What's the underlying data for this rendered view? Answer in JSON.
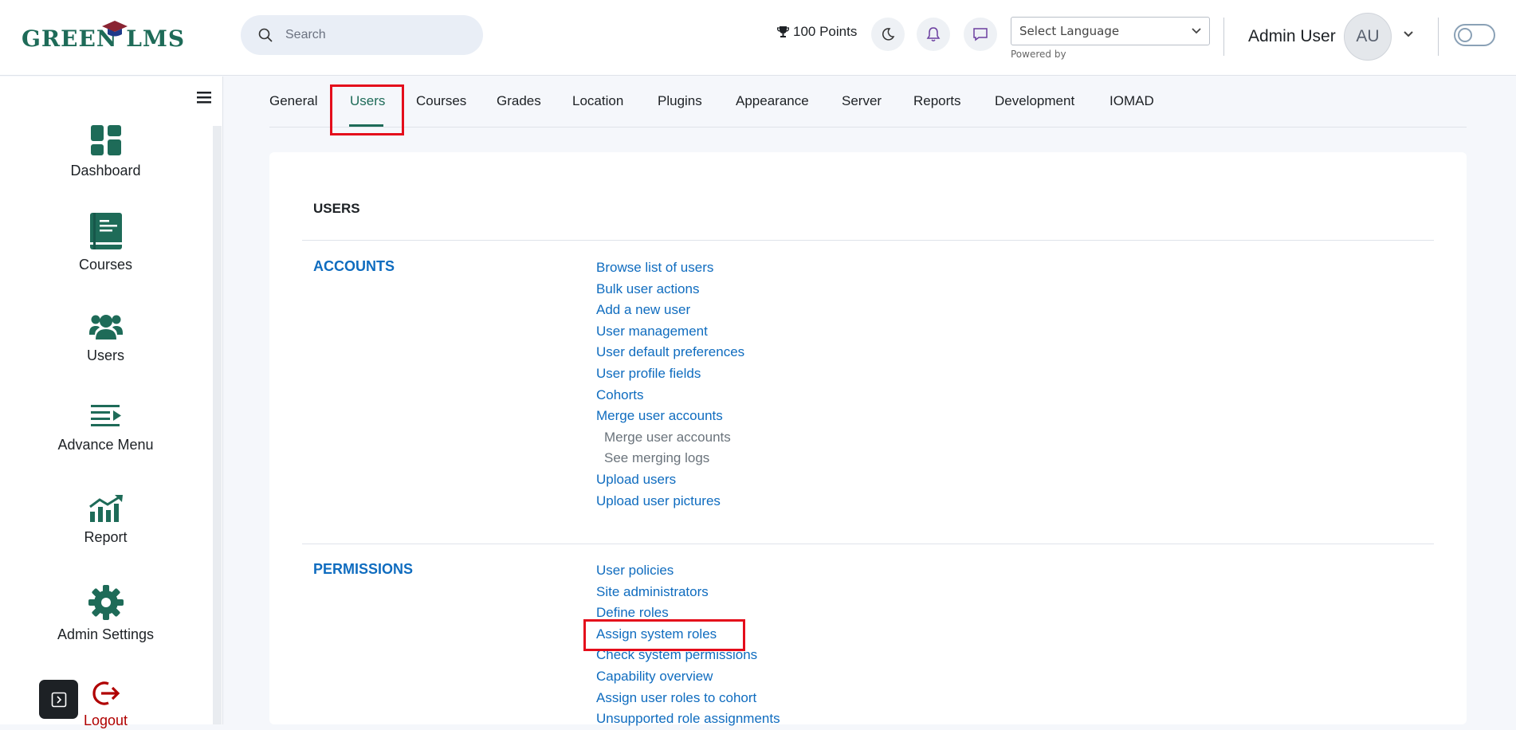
{
  "header": {
    "logo_text": "GREEN LMS",
    "search_placeholder": "Search",
    "points": "100 Points",
    "language_select": "Select Language",
    "powered_by": "Powered by",
    "user_name": "Admin User",
    "avatar_initials": "AU"
  },
  "sidebar": {
    "items": [
      {
        "label": "Dashboard",
        "icon": "dashboard-icon"
      },
      {
        "label": "Courses",
        "icon": "book-icon"
      },
      {
        "label": "Users",
        "icon": "users-icon"
      },
      {
        "label": "Advance Menu",
        "icon": "menu-arrow-icon"
      },
      {
        "label": "Report",
        "icon": "chart-icon"
      },
      {
        "label": "Admin Settings",
        "icon": "gear-icon"
      },
      {
        "label": "Logout",
        "icon": "logout-icon"
      }
    ]
  },
  "tabs": [
    "General",
    "Users",
    "Courses",
    "Grades",
    "Location",
    "Plugins",
    "Appearance",
    "Server",
    "Reports",
    "Development",
    "IOMAD"
  ],
  "active_tab": "Users",
  "content": {
    "section_title": "USERS",
    "categories": [
      {
        "title": "ACCOUNTS",
        "links": [
          {
            "label": "Browse list of users",
            "sub": false
          },
          {
            "label": "Bulk user actions",
            "sub": false
          },
          {
            "label": "Add a new user",
            "sub": false
          },
          {
            "label": "User management",
            "sub": false
          },
          {
            "label": "User default preferences",
            "sub": false
          },
          {
            "label": "User profile fields",
            "sub": false
          },
          {
            "label": "Cohorts",
            "sub": false
          },
          {
            "label": "Merge user accounts",
            "sub": false
          },
          {
            "label": "Merge user accounts",
            "sub": true
          },
          {
            "label": "See merging logs",
            "sub": true
          },
          {
            "label": "Upload users",
            "sub": false
          },
          {
            "label": "Upload user pictures",
            "sub": false
          }
        ]
      },
      {
        "title": "PERMISSIONS",
        "links": [
          {
            "label": "User policies",
            "sub": false
          },
          {
            "label": "Site administrators",
            "sub": false
          },
          {
            "label": "Define roles",
            "sub": false
          },
          {
            "label": "Assign system roles",
            "sub": false
          },
          {
            "label": "Check system permissions",
            "sub": false
          },
          {
            "label": "Capability overview",
            "sub": false
          },
          {
            "label": "Assign user roles to cohort",
            "sub": false
          },
          {
            "label": "Unsupported role assignments",
            "sub": false
          }
        ]
      }
    ]
  },
  "colors": {
    "brand": "#1e6b58",
    "link": "#0f6cbf",
    "highlight": "#e40d1b",
    "logout": "#b00000"
  }
}
